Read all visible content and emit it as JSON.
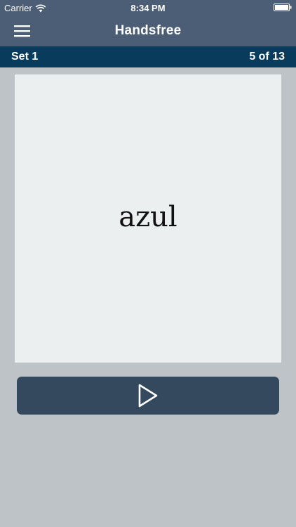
{
  "status_bar": {
    "carrier": "Carrier",
    "time": "8:34 PM",
    "icons": [
      "wifi-icon",
      "battery-icon"
    ]
  },
  "nav": {
    "title": "Handsfree",
    "menu_icon": "hamburger-menu-icon"
  },
  "set_bar": {
    "name": "Set 1",
    "progress": "5 of 13"
  },
  "card": {
    "word": "azul"
  },
  "play_button": {
    "icon": "play-icon"
  },
  "colors": {
    "header": "#4c5e75",
    "set_bar": "#083b5c",
    "background": "#bec3c8",
    "card": "#eceff0",
    "button": "#34495e"
  }
}
